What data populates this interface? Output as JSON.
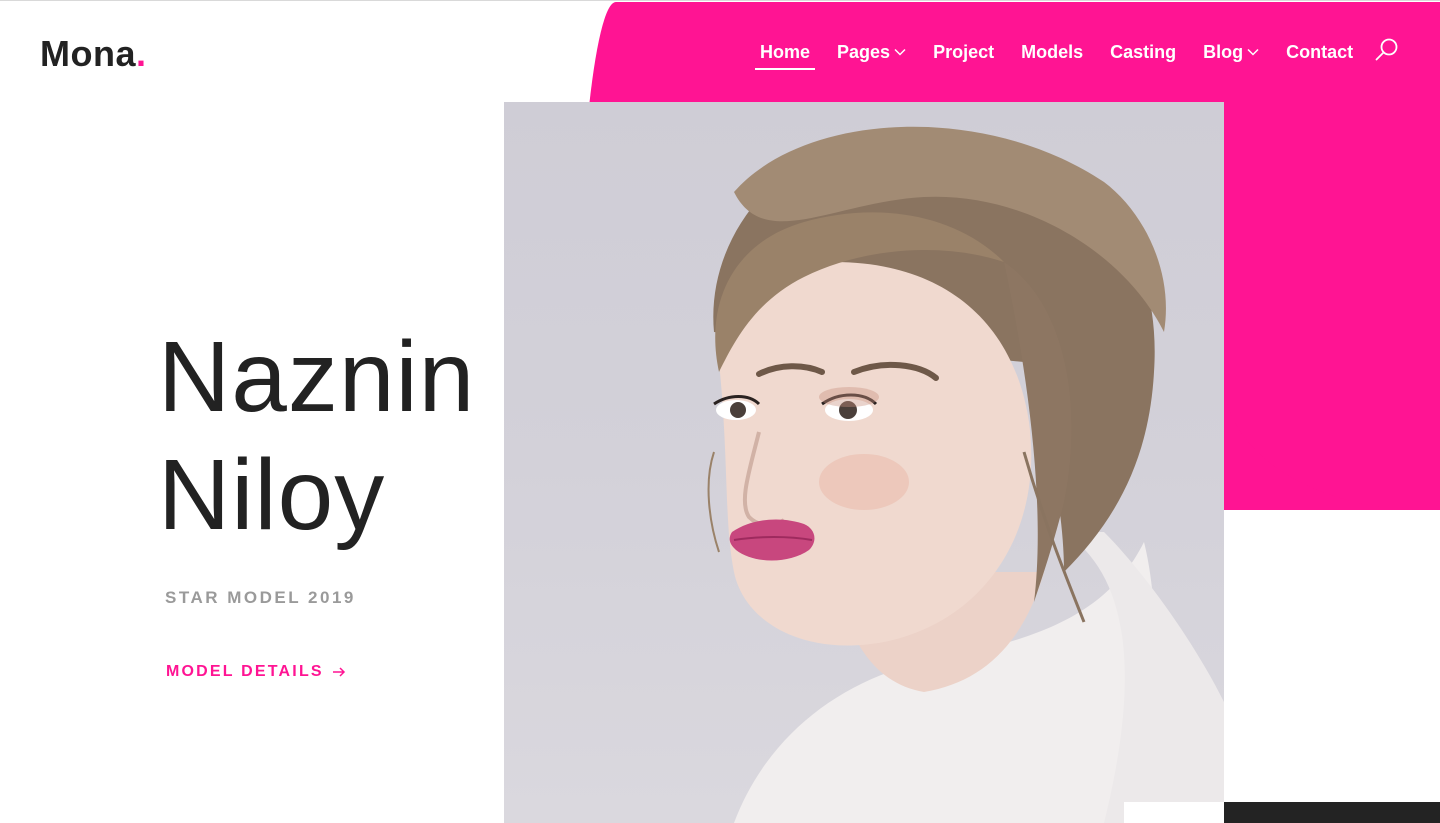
{
  "brand": {
    "name": "Mona",
    "dot": ".",
    "accent_color": "#ff1493"
  },
  "nav": {
    "items": [
      {
        "label": "Home",
        "active": true,
        "has_dropdown": false
      },
      {
        "label": "Pages",
        "active": false,
        "has_dropdown": true
      },
      {
        "label": "Project",
        "active": false,
        "has_dropdown": false
      },
      {
        "label": "Models",
        "active": false,
        "has_dropdown": false
      },
      {
        "label": "Casting",
        "active": false,
        "has_dropdown": false
      },
      {
        "label": "Blog",
        "active": false,
        "has_dropdown": true
      },
      {
        "label": "Contact",
        "active": false,
        "has_dropdown": false
      }
    ],
    "search_icon": "search-icon"
  },
  "hero": {
    "first_name": "Naznin",
    "last_name": "Niloy",
    "subtitle": "STAR MODEL 2019",
    "cta_label": "MODEL DETAILS",
    "cta_icon": "arrow-right-icon",
    "photo_subject": "model-portrait"
  },
  "colors": {
    "accent": "#ff1493",
    "text_dark": "#222222",
    "text_muted": "#9a9a9a",
    "footer_dark": "#232323"
  }
}
